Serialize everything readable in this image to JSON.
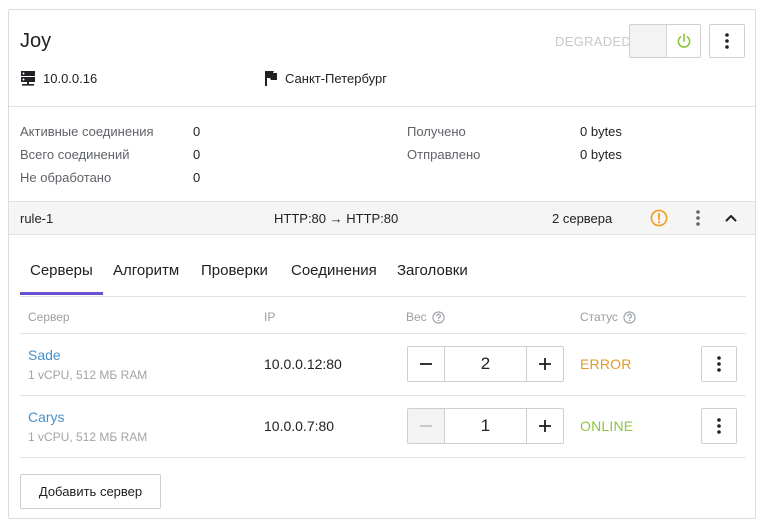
{
  "header": {
    "title": "Joy",
    "status": "DEGRADED",
    "ip": "10.0.0.16",
    "location": "Санкт-Петербург"
  },
  "stats": {
    "active_label": "Активные соединения",
    "active_value": "0",
    "total_label": "Всего соединений",
    "total_value": "0",
    "unprocessed_label": "Не обработано",
    "unprocessed_value": "0",
    "received_label": "Получено",
    "received_value": "0 bytes",
    "sent_label": "Отправлено",
    "sent_value": "0 bytes"
  },
  "rule": {
    "name": "rule-1",
    "mapping": "HTTP:80 → HTTP:80",
    "servers_count": "2 сервера"
  },
  "tabs": [
    "Серверы",
    "Алгоритм",
    "Проверки",
    "Соединения",
    "Заголовки"
  ],
  "active_tab": 0,
  "table": {
    "col_server": "Сервер",
    "col_ip": "IP",
    "col_weight": "Вес",
    "col_status": "Статус",
    "rows": [
      {
        "name": "Sade",
        "spec": "1 vCPU, 512 МБ RAM",
        "ip": "10.0.0.12:80",
        "weight": "2",
        "status": "ERROR"
      },
      {
        "name": "Carys",
        "spec": "1 vCPU, 512 МБ RAM",
        "ip": "10.0.0.7:80",
        "weight": "1",
        "status": "ONLINE"
      }
    ]
  },
  "add_server_label": "Добавить сервер",
  "colors": {
    "accent": "#6a4fd1",
    "link": "#4a90c8",
    "error": "#e09a2b",
    "online": "#8dc63f",
    "warning": "#f0a020",
    "power": "#8dc63f"
  },
  "icons": {
    "server": "server-icon",
    "location": "flag-icon",
    "power": "power-icon",
    "menu": "kebab-menu-icon",
    "warning": "warning-icon",
    "collapse": "chevron-up-icon",
    "help": "help-icon",
    "minus": "minus-icon",
    "plus": "plus-icon"
  }
}
